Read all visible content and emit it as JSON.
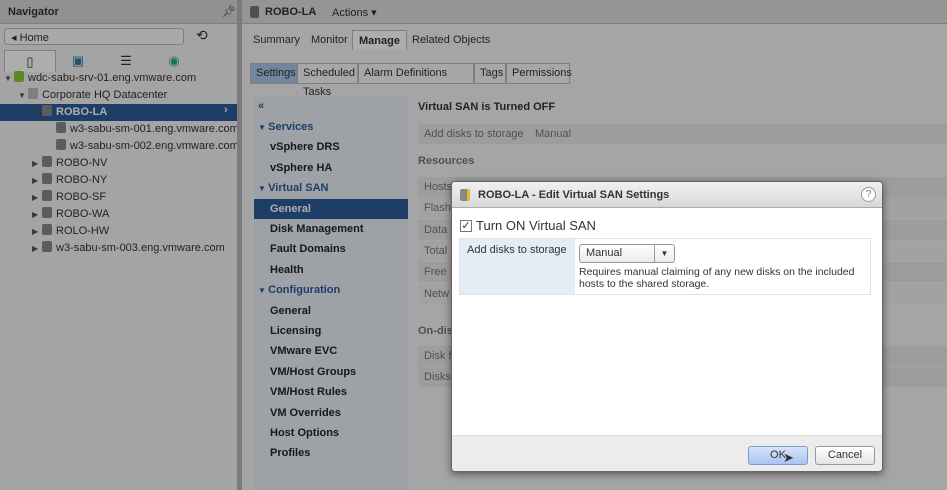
{
  "navigator": {
    "title": "Navigator",
    "home": "Home",
    "tree": [
      {
        "label": "wdc-sabu-srv-01.eng.vmware.com",
        "level": 0,
        "expanded": true
      },
      {
        "label": "Corporate HQ Datacenter",
        "level": 1,
        "expanded": true
      },
      {
        "label": "ROBO-LA",
        "level": 2,
        "expanded": true,
        "selected": true
      },
      {
        "label": "w3-sabu-sm-001.eng.vmware.com",
        "level": 3
      },
      {
        "label": "w3-sabu-sm-002.eng.vmware.com",
        "level": 3
      },
      {
        "label": "ROBO-NV",
        "level": 2
      },
      {
        "label": "ROBO-NY",
        "level": 2
      },
      {
        "label": "ROBO-SF",
        "level": 2
      },
      {
        "label": "ROBO-WA",
        "level": 2
      },
      {
        "label": "ROLO-HW",
        "level": 2
      },
      {
        "label": "w3-sabu-sm-003.eng.vmware.com",
        "level": 2
      }
    ]
  },
  "header": {
    "object": "ROBO-LA",
    "actions": "Actions ▾"
  },
  "tabs": [
    "Summary",
    "Monitor",
    "Manage",
    "Related Objects"
  ],
  "subtabs": [
    "Settings",
    "Scheduled Tasks",
    "Alarm Definitions",
    "Tags",
    "Permissions"
  ],
  "settings_menu": {
    "collapse": "«",
    "items": [
      {
        "label": "Services",
        "type": "h"
      },
      {
        "label": "vSphere DRS"
      },
      {
        "label": "vSphere HA"
      },
      {
        "label": "Virtual SAN",
        "type": "h"
      },
      {
        "label": "General",
        "selected": true
      },
      {
        "label": "Disk Management"
      },
      {
        "label": "Fault Domains"
      },
      {
        "label": "Health"
      },
      {
        "label": "Configuration",
        "type": "h"
      },
      {
        "label": "General"
      },
      {
        "label": "Licensing"
      },
      {
        "label": "VMware EVC"
      },
      {
        "label": "VM/Host Groups"
      },
      {
        "label": "VM/Host Rules"
      },
      {
        "label": "VM Overrides"
      },
      {
        "label": "Host Options"
      },
      {
        "label": "Profiles"
      }
    ]
  },
  "content": {
    "title": "Virtual SAN is Turned OFF",
    "add_disks_label": "Add disks to storage",
    "add_disks_value": "Manual",
    "resources": "Resources",
    "resource_rows": [
      "Hosts",
      "Flash",
      "Data",
      "Total",
      "Free",
      "Netw"
    ],
    "ondisk": "On-dis",
    "ondisk_rows": [
      "Disk f",
      "Disks"
    ]
  },
  "dialog": {
    "title": "ROBO-LA - Edit Virtual SAN Settings",
    "help": "?",
    "checkbox_label": "Turn ON Virtual SAN",
    "checked": true,
    "field_label": "Add disks to storage",
    "select_value": "Manual",
    "description": "Requires manual claiming of any new disks on the included hosts to the shared storage.",
    "ok": "OK",
    "cancel": "Cancel"
  }
}
